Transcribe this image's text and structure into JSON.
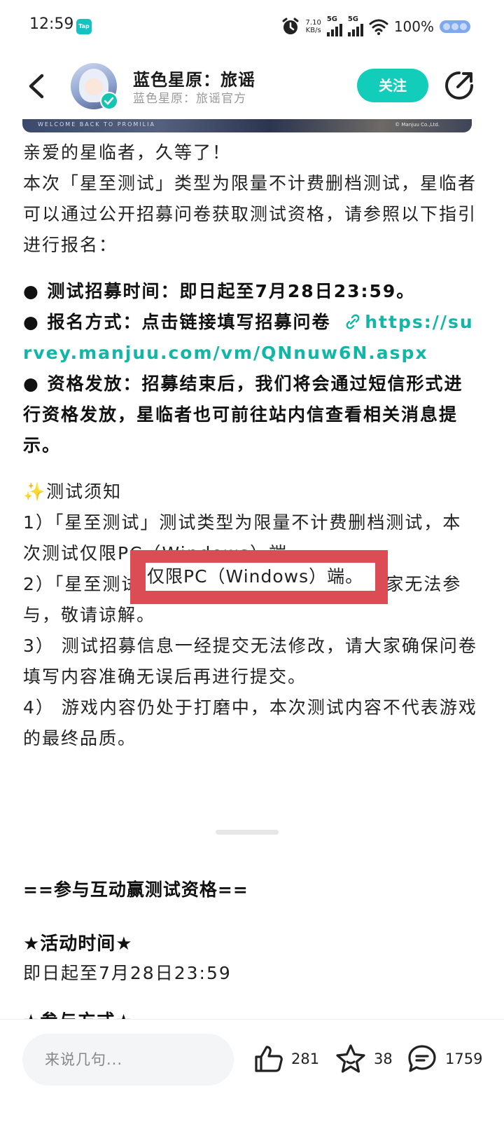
{
  "status_bar": {
    "time": "12:59",
    "app_badge": "Tap",
    "net_speed_value": "7.10",
    "net_speed_unit": "KB/s",
    "signal1_label": "5G",
    "signal2_label": "5G",
    "battery_percent": "100%"
  },
  "header": {
    "title": "蓝色星原：旅谣",
    "subtitle": "蓝色星原：旅谣官方",
    "follow_label": "关注"
  },
  "banner": {
    "welcome_text": "WELCOME BACK TO PROMILIA",
    "copyright": "© Manjuu Co.,Ltd."
  },
  "article": {
    "intro": [
      "亲爱的星临者，久等了！",
      "本次「星至测试」类型为限量不计费删档测试，星临者可以通过公开招募问卷获取测试资格，请参照以下指引进行报名："
    ],
    "recruit_time": "● 测试招募时间：即日起至7月28日23:59。",
    "signup_method": "● 报名方式：点击链接填写招募问卷",
    "signup_link": "https://survey.manjuu.com/vm/QNnuw6N.aspx",
    "qualification": "● 资格发放：招募结束后，我们将会通过短信形式进行资格发放，星临者也可前往站内信查看相关消息提示。",
    "notice_title": "✨测试须知",
    "notice_items": [
      "1）「星至测试」测试类型为限量不计费删档测试，本次测试仅限PC（Windows）端。",
      "2）「星至测试」已开通实名认证，未成年玩家无法参与，敬请谅解。",
      "3） 测试招募信息一经提交无法修改，请大家确保问卷填写内容准确无误后再进行提交。",
      "4） 游戏内容仍处于打磨中，本次测试内容不代表游戏的最终品质。"
    ],
    "highlight_text": "仅限PC（Windows）端。"
  },
  "section2": {
    "heading": "==参与互动赢测试资格==",
    "activity_time_title": "★活动时间★",
    "activity_time": "即日起至7月28日23:59",
    "cut_line": "★参与方式★"
  },
  "bottom_bar": {
    "comment_placeholder": "来说几句...",
    "likes": "281",
    "favorites": "38",
    "comments": "1759"
  },
  "colors": {
    "accent": "#13cdbb",
    "link": "#10b7a6",
    "highlight_border": "#dc4c55"
  }
}
